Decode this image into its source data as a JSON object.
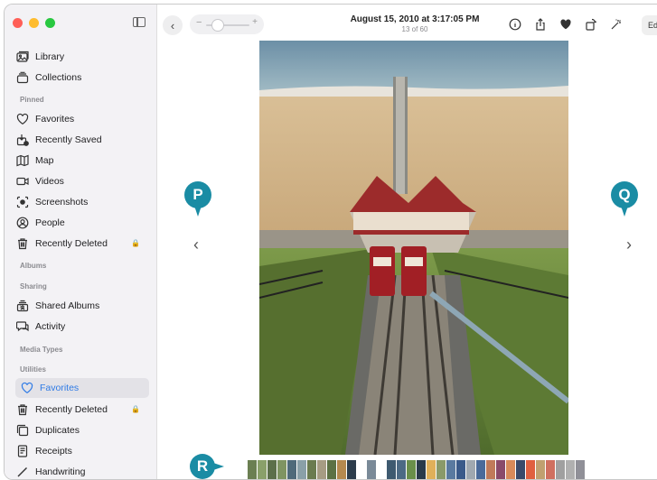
{
  "toolbar": {
    "title": "August 15, 2010 at 3:17:05 PM",
    "count": "13 of 60",
    "zoom_minus": "−",
    "zoom_plus": "+",
    "edit_label": "Edi"
  },
  "sidebar": {
    "top": [
      {
        "label": "Library",
        "icon": "library-icon"
      },
      {
        "label": "Collections",
        "icon": "collections-icon"
      }
    ],
    "pinned_header": "Pinned",
    "pinned": [
      {
        "label": "Favorites",
        "icon": "heart-icon"
      },
      {
        "label": "Recently Saved",
        "icon": "recently-saved-icon"
      },
      {
        "label": "Map",
        "icon": "map-icon"
      },
      {
        "label": "Videos",
        "icon": "video-icon"
      },
      {
        "label": "Screenshots",
        "icon": "screenshot-icon"
      },
      {
        "label": "People",
        "icon": "person-icon"
      },
      {
        "label": "Recently Deleted",
        "icon": "trash-icon"
      }
    ],
    "albums_header": "Albums",
    "sharing_header": "Sharing",
    "sharing": [
      {
        "label": "Shared Albums",
        "icon": "shared-albums-icon"
      },
      {
        "label": "Activity",
        "icon": "activity-icon"
      }
    ],
    "media_types_header": "Media Types",
    "utilities_header": "Utilities",
    "utilities": [
      {
        "label": "Favorites",
        "icon": "heart-icon"
      },
      {
        "label": "Recently Deleted",
        "icon": "trash-icon"
      },
      {
        "label": "Duplicates",
        "icon": "duplicates-icon"
      },
      {
        "label": "Receipts",
        "icon": "receipt-icon"
      },
      {
        "label": "Handwriting",
        "icon": "pen-icon"
      }
    ]
  },
  "callouts": {
    "p": "P",
    "q": "Q",
    "r": "R"
  },
  "colors": {
    "accent": "#2f7be6",
    "callout": "#1a8ca4",
    "traffic_red": "#ff5f57",
    "traffic_yellow": "#febc2e",
    "traffic_green": "#28c840"
  }
}
